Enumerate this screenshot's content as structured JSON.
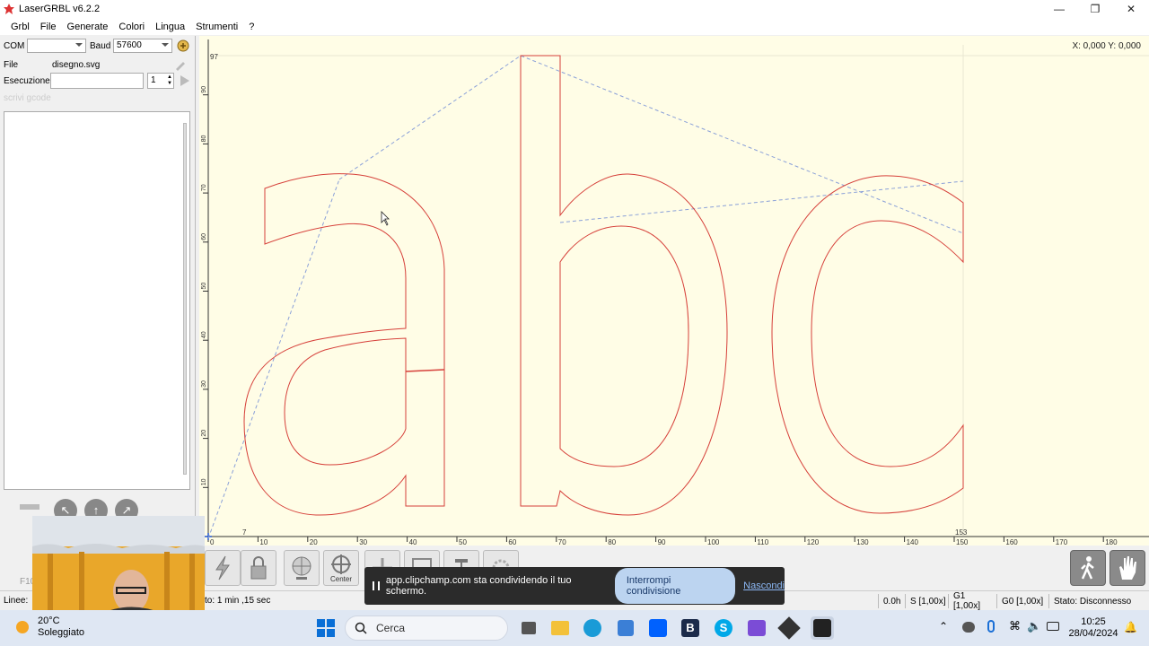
{
  "window": {
    "title": "LaserGRBL v6.2.2"
  },
  "menu": [
    "Grbl",
    "File",
    "Generate",
    "Colori",
    "Lingua",
    "Strumenti",
    "?"
  ],
  "left": {
    "com_label": "COM",
    "com_value": "",
    "baud_label": "Baud",
    "baud_value": "57600",
    "file_label": "File",
    "file_value": "disegno.svg",
    "exec_label": "Esecuzione",
    "exec_value": "",
    "exec_count": "1",
    "gcode_placeholder": "scrivi gcode"
  },
  "canvas": {
    "coords": "X: 0,000 Y: 0,000",
    "x_ticks": [
      "0",
      "10",
      "20",
      "30",
      "40",
      "50",
      "60",
      "70",
      "80",
      "90",
      "100",
      "110",
      "120",
      "130",
      "140",
      "150",
      "160",
      "170",
      "180"
    ],
    "y_ticks": [
      "10",
      "20",
      "30",
      "40",
      "50",
      "60",
      "70",
      "80",
      "90"
    ],
    "y_max_label": "97",
    "x_min_label": "7",
    "x_max_label": "153",
    "stroke_color": "#d6403a"
  },
  "toolbar": {
    "center_label": "Center"
  },
  "status": {
    "lines_label": "Linee:",
    "time": "to:  1 min ,15 sec",
    "hours": "0.0h",
    "s": "S [1,00x]",
    "g1": "G1 [1,00x]",
    "g0": "G0 [1,00x]",
    "state": "Stato:  Disconnesso",
    "f10": "F10"
  },
  "share": {
    "message": "app.clipchamp.com sta condividendo il tuo schermo.",
    "stop": "Interrompi condivisione",
    "hide": "Nascondi"
  },
  "taskbar": {
    "temp": "20°C",
    "weather": "Soleggiato",
    "search": "Cerca",
    "time": "10:25",
    "date": "28/04/2024"
  }
}
